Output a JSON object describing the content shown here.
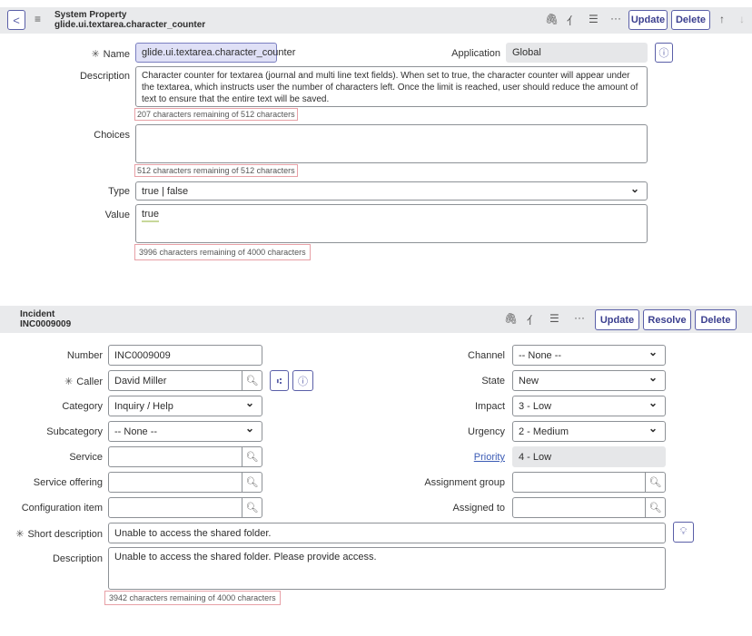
{
  "property": {
    "header": {
      "type": "System Property",
      "name": "glide.ui.textarea.character_counter",
      "update": "Update",
      "delete": "Delete"
    },
    "name_label": "Name",
    "name_value": "glide.ui.textarea.character_counter",
    "application_label": "Application",
    "application_value": "Global",
    "description_label": "Description",
    "description_value": "Character counter for textarea (journal and multi line text fields).  When set to true, the character counter will appear under the textarea, which instructs user the number of characters left. Once the limit is reached, user should reduce the amount of text to ensure that the entire text will be saved.",
    "description_counter": "207 characters remaining of 512 characters",
    "choices_label": "Choices",
    "choices_value": "",
    "choices_counter": "512 characters remaining of 512 characters",
    "type_label": "Type",
    "type_value": "true | false",
    "value_label": "Value",
    "value_value": "true",
    "value_counter": "3996 characters remaining of 4000 characters"
  },
  "incident": {
    "header": {
      "type": "Incident",
      "number": "INC0009009",
      "update": "Update",
      "resolve": "Resolve",
      "delete": "Delete"
    },
    "number_label": "Number",
    "number_value": "INC0009009",
    "caller_label": "Caller",
    "caller_value": "David Miller",
    "category_label": "Category",
    "category_value": "Inquiry / Help",
    "subcategory_label": "Subcategory",
    "subcategory_value": "-- None --",
    "service_label": "Service",
    "service_value": "",
    "service_offering_label": "Service offering",
    "service_offering_value": "",
    "ci_label": "Configuration item",
    "ci_value": "",
    "channel_label": "Channel",
    "channel_value": "-- None --",
    "state_label": "State",
    "state_value": "New",
    "impact_label": "Impact",
    "impact_value": "3 - Low",
    "urgency_label": "Urgency",
    "urgency_value": "2 - Medium",
    "priority_label": "Priority",
    "priority_value": "4 - Low",
    "assignment_group_label": "Assignment group",
    "assignment_group_value": "",
    "assigned_to_label": "Assigned to",
    "assigned_to_value": "",
    "short_description_label": "Short description",
    "short_description_value": "Unable to access the shared folder.",
    "description_label": "Description",
    "description_value": "Unable to access the shared folder. Please provide access.",
    "description_counter": "3942 characters remaining of 4000 characters"
  }
}
